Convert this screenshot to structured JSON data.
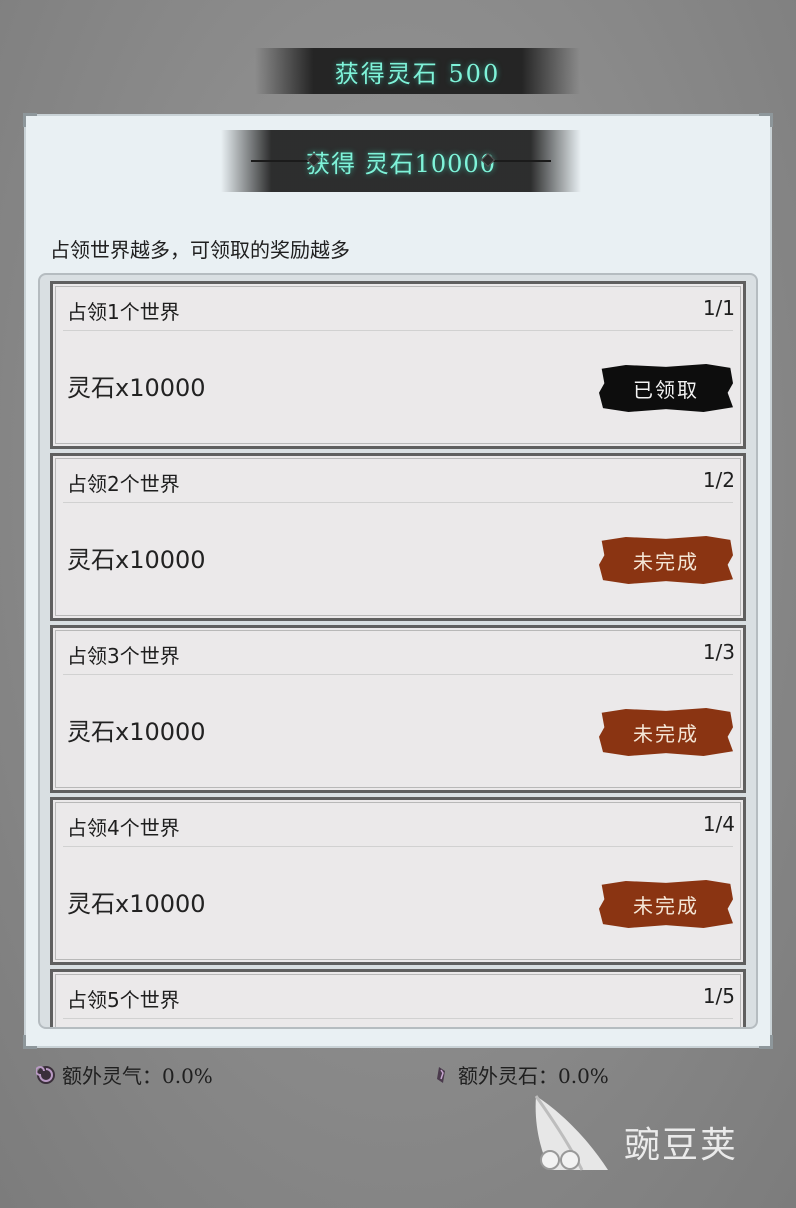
{
  "toast": {
    "text": "获得灵石 500"
  },
  "panel": {
    "banner_text": "获得 灵石10000",
    "subtitle": "占领世界越多，可领取的奖励越多"
  },
  "rewards": [
    {
      "title": "占领1个世界",
      "progress": "1/1",
      "reward": "灵石x10000",
      "status": "已领取"
    },
    {
      "title": "占领2个世界",
      "progress": "1/2",
      "reward": "灵石x10000",
      "status": "未完成"
    },
    {
      "title": "占领3个世界",
      "progress": "1/3",
      "reward": "灵石x10000",
      "status": "未完成"
    },
    {
      "title": "占领4个世界",
      "progress": "1/4",
      "reward": "灵石x10000",
      "status": "未完成"
    },
    {
      "title": "占领5个世界",
      "progress": "1/5"
    }
  ],
  "footer": {
    "extra_qi_label": "额外灵气：0.0%",
    "extra_stone_label": "额外灵石：0.0%"
  },
  "watermark": {
    "text": "豌豆荚"
  },
  "colors": {
    "glow_text": "#7ff3d9",
    "claimed_button": "#0d0d0d",
    "pending_button": "#8a3412",
    "panel_bg": "#e9f0f3"
  },
  "icons": [
    "swirl-qi-icon",
    "spirit-stone-icon",
    "wandoujia-logo-icon"
  ]
}
